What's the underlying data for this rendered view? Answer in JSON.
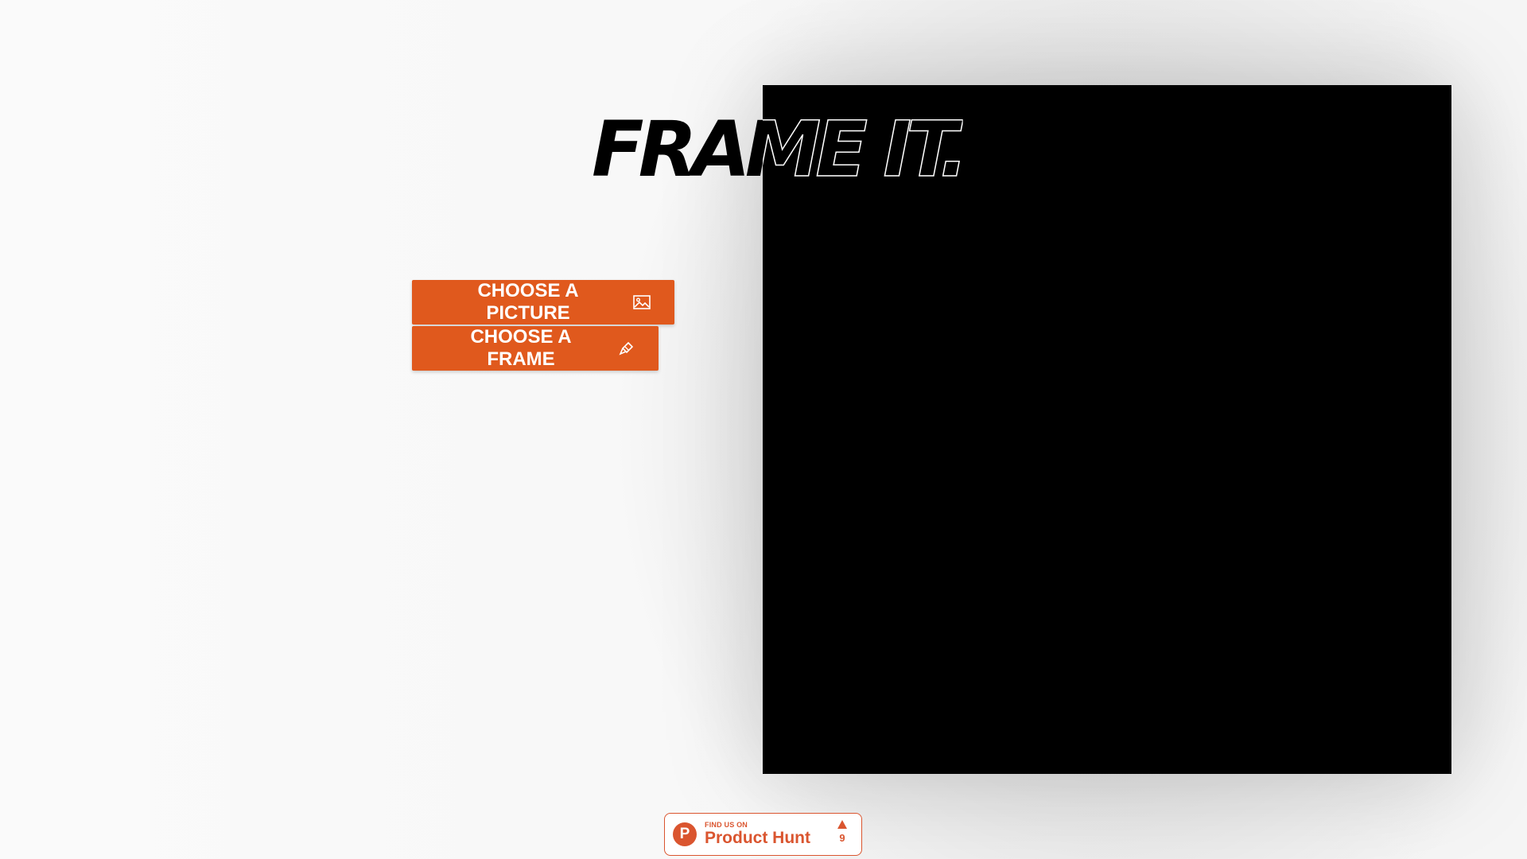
{
  "header": {
    "title": "FRAME IT."
  },
  "actions": {
    "choose_picture_label": "CHOOSE A PICTURE",
    "choose_picture_icon": "image-icon",
    "choose_frame_label": "CHOOSE A FRAME",
    "choose_frame_icon": "brush-icon"
  },
  "product_hunt": {
    "small_text": "FIND US ON",
    "name": "Product Hunt",
    "logo_letter": "P",
    "upvote_count": "9",
    "upvote_icon": "upvote-arrow-icon"
  },
  "colors": {
    "accent": "#e0591d",
    "product_hunt": "#da552f",
    "canvas": "#000000"
  }
}
